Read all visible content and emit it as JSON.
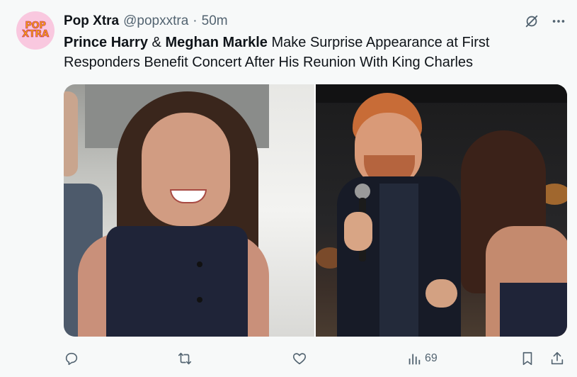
{
  "author": {
    "display_name": "Pop Xtra",
    "handle": "@popxxtra",
    "separator": "·",
    "time": "50m",
    "avatar_text_line1": "POP",
    "avatar_text_line2": "XTRA"
  },
  "tweet": {
    "name1": "Prince Harry",
    "amp": "&",
    "name2": "Meghan Markle",
    "rest": "Make Surprise Appearance at First Responders Benefit Concert After His Reunion With King Charles"
  },
  "header_icons": [
    "grok-icon",
    "more-icon"
  ],
  "actions": {
    "views": "69",
    "icons": [
      "reply-icon",
      "retweet-icon",
      "like-icon",
      "views-icon",
      "bookmark-icon",
      "share-icon"
    ]
  },
  "colors": {
    "text": "#0f1419",
    "secondary": "#536471",
    "background": "#f7f9f9",
    "avatar_bg": "#f9c8df"
  }
}
